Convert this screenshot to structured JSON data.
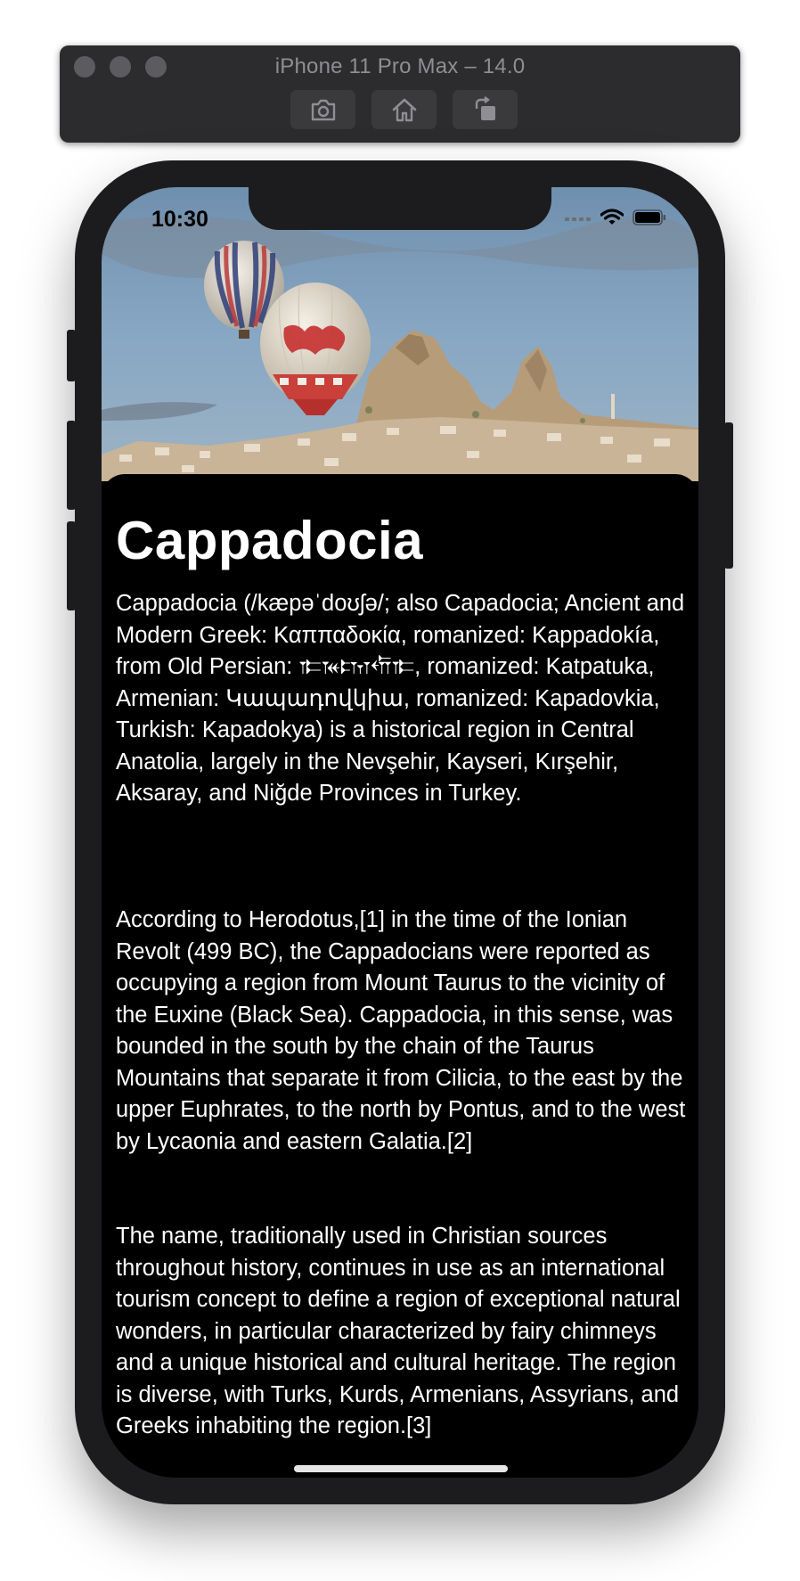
{
  "simulator": {
    "title": "iPhone 11 Pro Max – 14.0",
    "buttons": [
      {
        "icon": "screenshot-camera-icon"
      },
      {
        "icon": "home-icon"
      },
      {
        "icon": "rotate-icon"
      }
    ]
  },
  "status_bar": {
    "time": "10:30",
    "icons": [
      "signal-icon",
      "wifi-icon",
      "battery-icon"
    ]
  },
  "hero_image": {
    "subject": "hot-air balloons over Cappadocia"
  },
  "article": {
    "title": "Cappadocia",
    "paragraphs": [
      "Cappadocia (/kæpəˈdoʊʃə/; also Capadocia; Ancient and Modern Greek: Καππαδοκία, romanized: Kappadokía, from Old Persian: 𐎣𐎳𐎫𐎢𐎣, romanized: Katpatuka, Armenian: Կապադովկիա, romanized: Kapadovkia, Turkish: Kapadokya) is a historical region in Central Anatolia, largely in the Nevşehir, Kayseri, Kırşehir, Aksaray, and Niğde Provinces in Turkey.",
      "According to Herodotus,[1] in the time of the Ionian Revolt (499 BC), the Cappadocians were reported as occupying a region from Mount Taurus to the vicinity of the Euxine (Black Sea). Cappadocia, in this sense, was bounded in the south by the chain of the Taurus Mountains that separate it from Cilicia, to the east by the upper Euphrates, to the north by Pontus, and to the west by Lycaonia and eastern Galatia.[2]",
      "The name, traditionally used in Christian sources throughout history, continues in use as an international tourism concept to define a region of exceptional natural wonders, in particular characterized by fairy chimneys and a unique historical and cultural heritage. The region is diverse, with Turks, Kurds, Armenians, Assyrians, and Greeks inhabiting the region.[3]"
    ]
  },
  "colors": {
    "card_background": "#000000",
    "text": "#ffffff",
    "device_frame": "#1c1c1e"
  }
}
